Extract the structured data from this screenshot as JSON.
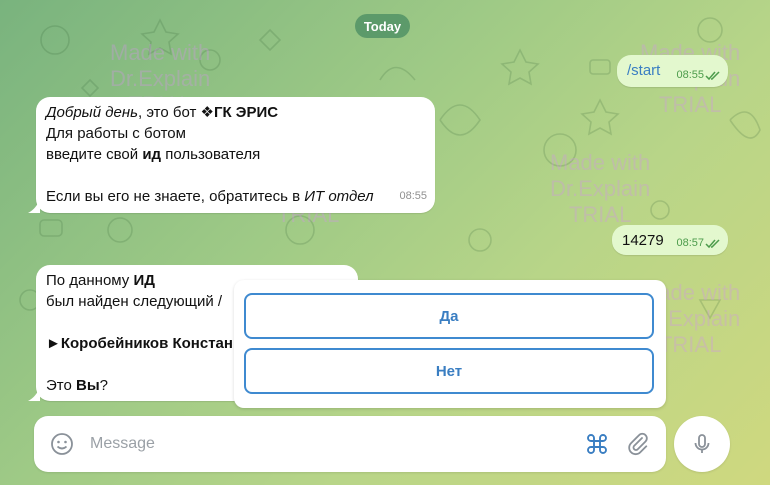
{
  "date_label": "Today",
  "messages": {
    "start": {
      "text": "/start",
      "time": "08:55"
    },
    "welcome": {
      "l1_italic": "Добрый день",
      "l1_rest": ", это бот ",
      "l1_bold": "❖ГК ЭРИС",
      "l2": "Для работы с ботом",
      "l3_a": "введите свой ",
      "l3_bold": "ид",
      "l3_b": " пользователя",
      "l4_a": "Если вы его не знаете, обратитесь в ",
      "l4_italic": "ИТ отдел",
      "time": "08:55"
    },
    "id_msg": {
      "text": "14279",
      "time": "08:57"
    },
    "found": {
      "l1_a": "По данному ",
      "l1_bold": "ИД",
      "l2": "был найден следующий /",
      "l3_arrow": "►",
      "l3_bold": "Коробейников Констан",
      "l4_a": "Это ",
      "l4_bold": "Вы",
      "l4_b": "?"
    }
  },
  "keyboard": {
    "yes": "Да",
    "no": "Нет"
  },
  "composer": {
    "placeholder": "Message"
  },
  "watermark": {
    "l1": "Made with",
    "l2": "Dr.Explain",
    "l3": "TRIAL"
  },
  "colors": {
    "accent": "#3a7ec2",
    "outgoing_bubble": "#e3f8ce",
    "read_check": "#4d9c4c"
  },
  "icons": [
    "emoji-icon",
    "command-icon",
    "attach-icon",
    "mic-icon",
    "double-check-icon"
  ]
}
